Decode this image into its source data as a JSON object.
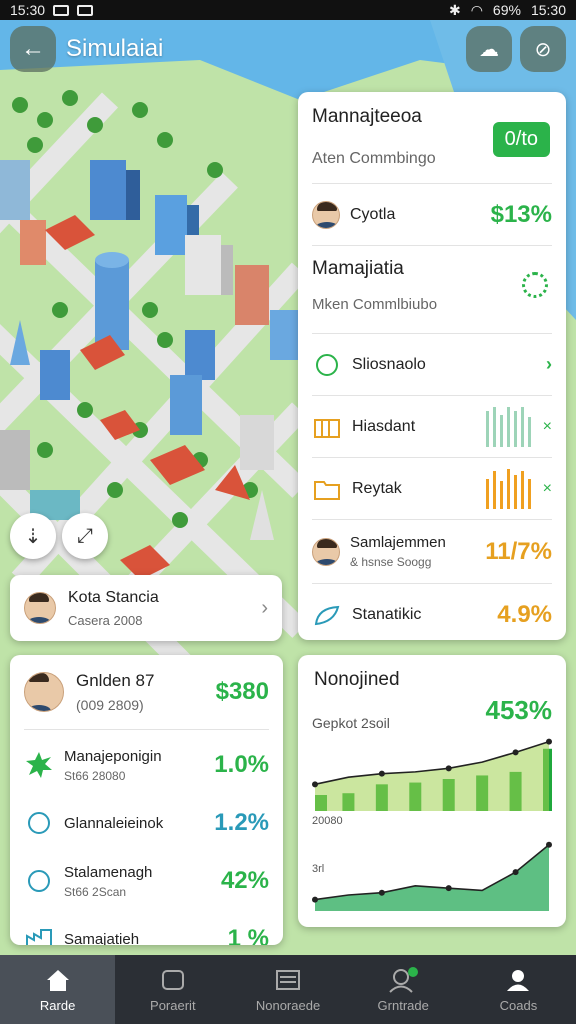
{
  "status": {
    "time_left": "15:30",
    "battery": "69%",
    "time_right": "15:30"
  },
  "header": {
    "title": "Simulaiai"
  },
  "right_panel": {
    "title": "Mannajteeoa",
    "subtitle": "Aten Commbingo",
    "pill": "0/to",
    "row1": {
      "label": "Cyotla",
      "value": "$13%"
    },
    "section2": {
      "title": "Mamajiatia",
      "subtitle": "Mken Commlbiubo"
    },
    "rows": [
      {
        "label": "Sliosnaolo",
        "value": ""
      },
      {
        "label": "Hiasdant",
        "value": ""
      },
      {
        "label": "Reytak",
        "value": ""
      },
      {
        "label": "Samlajemmen",
        "sub": "& hsnse Soogg",
        "value": "11/7%"
      },
      {
        "label": "Stanatikic",
        "value": "4.9%"
      }
    ]
  },
  "left_card": {
    "name": "Kota Stancia",
    "sub": "Casera 2008"
  },
  "stats_card": {
    "name": "Gnlden 87",
    "sub": "(009 2809)",
    "money": "$380",
    "rows": [
      {
        "label": "Manajeponigin",
        "sub": "St66 28080",
        "value": "1.0%"
      },
      {
        "label": "Glannaleieinok",
        "sub": "",
        "value": "1.2%"
      },
      {
        "label": "Stalamenagh",
        "sub": "St66 2Scan",
        "value": "42%"
      },
      {
        "label": "Samajatieh",
        "sub": "",
        "value": "1 %"
      }
    ]
  },
  "chart_card": {
    "title": "Nonojined",
    "subtitle": "Gepkot 2soil",
    "value": "453%",
    "tick_top": "20080",
    "tick_bottom": "3rl"
  },
  "chart_data": [
    {
      "type": "area",
      "title": "",
      "x": [
        1,
        2,
        3,
        4,
        5,
        6,
        7,
        8
      ],
      "series": [
        {
          "values": [
            30,
            38,
            42,
            44,
            48,
            55,
            66,
            78
          ]
        }
      ],
      "bars": [
        18,
        20,
        30,
        32,
        36,
        40,
        44,
        70
      ],
      "ylim": [
        0,
        90
      ]
    },
    {
      "type": "area",
      "title": "",
      "x": [
        1,
        2,
        3,
        4,
        5,
        6,
        7,
        8
      ],
      "series": [
        {
          "values": [
            10,
            14,
            16,
            22,
            20,
            18,
            34,
            58
          ]
        }
      ],
      "ylim": [
        0,
        70
      ]
    }
  ],
  "nav": [
    {
      "label": "Rarde",
      "icon": "home-icon"
    },
    {
      "label": "Poraerit",
      "icon": "box-icon"
    },
    {
      "label": "Nonoraede",
      "icon": "list-icon"
    },
    {
      "label": "Grntrade",
      "icon": "person-badge-icon"
    },
    {
      "label": "Coads",
      "icon": "user-icon"
    }
  ]
}
